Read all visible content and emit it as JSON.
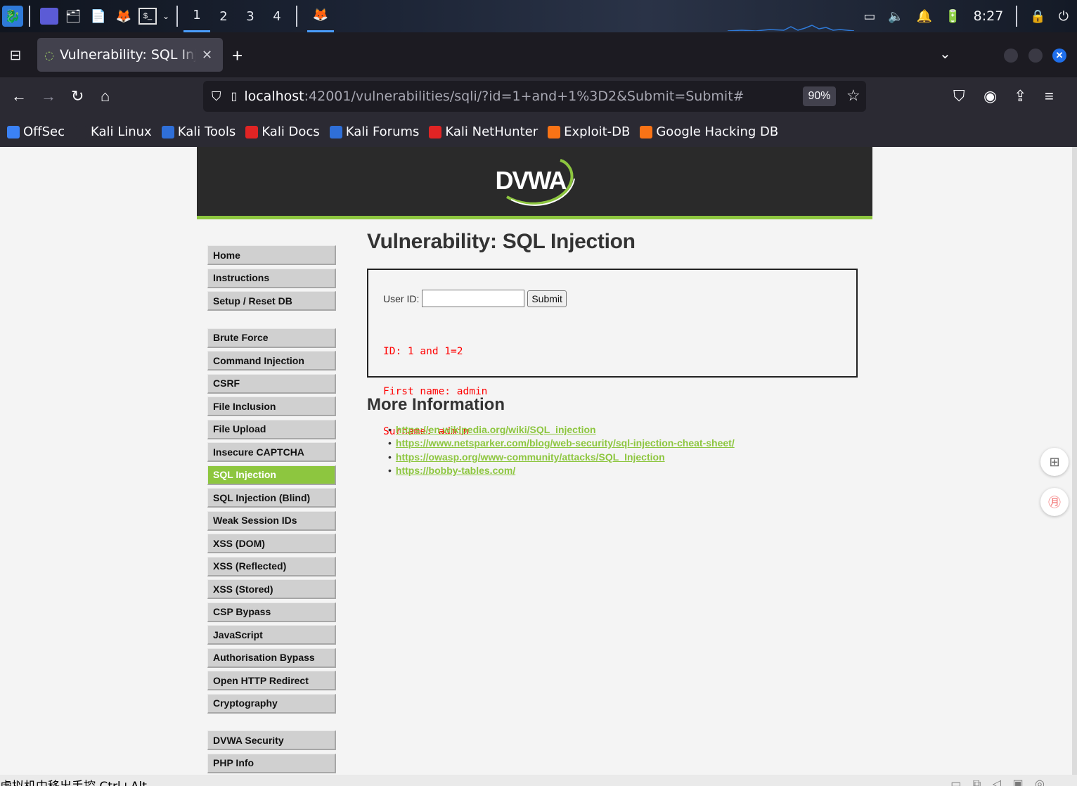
{
  "taskbar": {
    "workspaces": [
      "1",
      "2",
      "3",
      "4"
    ],
    "active_workspace": "1",
    "time": "8:27"
  },
  "browser": {
    "tab_title": "Vulnerability: SQL Injection",
    "url_host": "localhost",
    "url_rest": ":42001/vulnerabilities/sqli/?id=1+and+1%3D2&Submit=Submit#",
    "zoom": "90%",
    "bookmarks": [
      {
        "label": "OffSec",
        "color": "#3b82f6"
      },
      {
        "label": "Kali Linux",
        "color": "#2b2a33"
      },
      {
        "label": "Kali Tools",
        "color": "#2f6fd8"
      },
      {
        "label": "Kali Docs",
        "color": "#e02424"
      },
      {
        "label": "Kali Forums",
        "color": "#2f6fd8"
      },
      {
        "label": "Kali NetHunter",
        "color": "#e02424"
      },
      {
        "label": "Exploit-DB",
        "color": "#f97316"
      },
      {
        "label": "Google Hacking DB",
        "color": "#f97316"
      }
    ]
  },
  "page": {
    "logo": "DVWA",
    "title": "Vulnerability: SQL Injection",
    "form": {
      "label": "User ID:",
      "input_value": "",
      "submit_label": "Submit"
    },
    "result_lines": [
      "ID: 1 and 1=2",
      "First name: admin",
      "Surname: admin"
    ],
    "more_info_title": "More Information",
    "links": [
      "https://en.wikipedia.org/wiki/SQL_injection",
      "https://www.netsparker.com/blog/web-security/sql-injection-cheat-sheet/",
      "https://owasp.org/www-community/attacks/SQL_Injection",
      "https://bobby-tables.com/"
    ],
    "menu_group1": [
      "Home",
      "Instructions",
      "Setup / Reset DB"
    ],
    "menu_group2": [
      "Brute Force",
      "Command Injection",
      "CSRF",
      "File Inclusion",
      "File Upload",
      "Insecure CAPTCHA",
      "SQL Injection",
      "SQL Injection (Blind)",
      "Weak Session IDs",
      "XSS (DOM)",
      "XSS (Reflected)",
      "XSS (Stored)",
      "CSP Bypass",
      "JavaScript",
      "Authorisation Bypass",
      "Open HTTP Redirect",
      "Cryptography"
    ],
    "menu_group3": [
      "DVWA Security",
      "PHP Info"
    ],
    "selected_menu": "SQL Injection"
  },
  "status_bar": {
    "text": "虚拟机中移出手控 Ctrl+Alt"
  },
  "colors": {
    "accent": "#8dc63f",
    "result_red": "#ff0000",
    "header_dark": "#2a2a2a"
  }
}
